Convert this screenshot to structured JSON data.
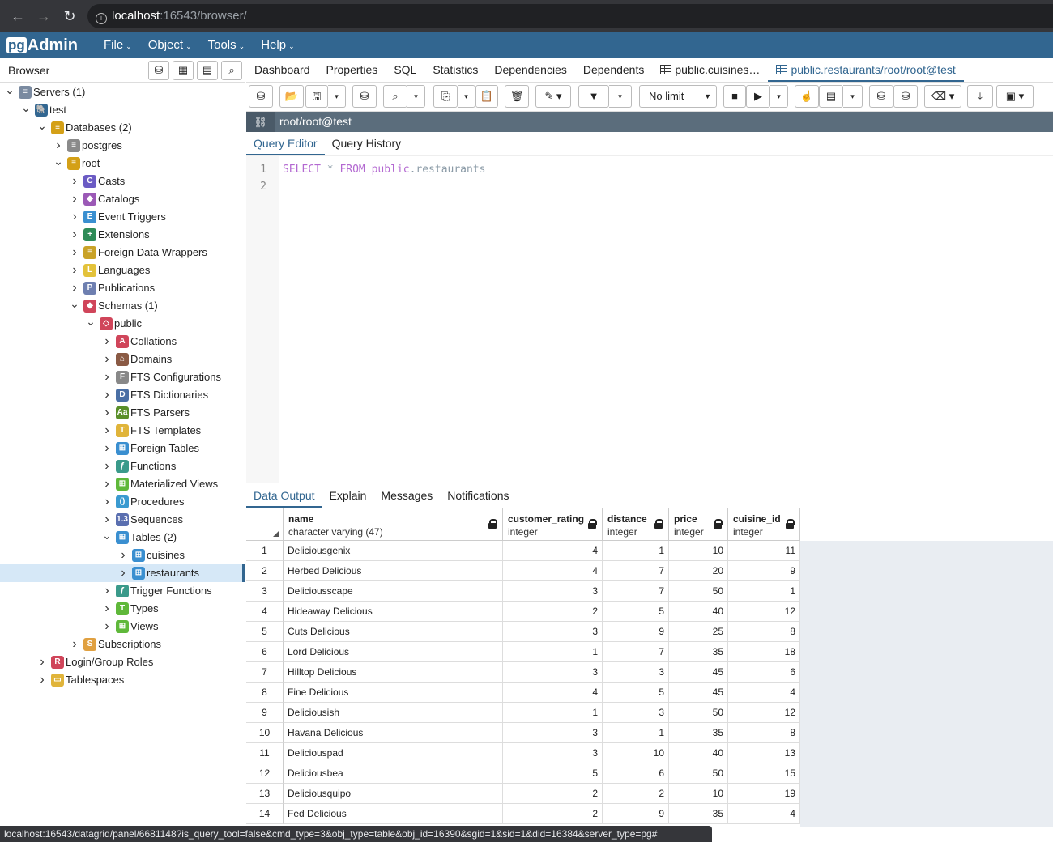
{
  "browser": {
    "url_host": "localhost",
    "url_path": ":16543/browser/",
    "status_url": "localhost:16543/datagrid/panel/6681148?is_query_tool=false&cmd_type=3&obj_type=table&obj_id=16390&sgid=1&sid=1&did=16384&server_type=pg#"
  },
  "app": {
    "logo_pg": "pg",
    "logo_admin": "Admin",
    "menu": [
      "File",
      "Object",
      "Tools",
      "Help"
    ]
  },
  "sidebar": {
    "title": "Browser",
    "tree": [
      {
        "label": "Servers (1)",
        "depth": 0,
        "chev": "v",
        "icon": "servers-icon",
        "color": "#7a8aa0",
        "glyph": "≡"
      },
      {
        "label": "test",
        "depth": 1,
        "chev": "v",
        "icon": "elephant-icon",
        "color": "#336791",
        "glyph": "🐘"
      },
      {
        "label": "Databases (2)",
        "depth": 2,
        "chev": "v",
        "icon": "databases-icon",
        "color": "#d4a017",
        "glyph": "≡"
      },
      {
        "label": "postgres",
        "depth": 3,
        "chev": ">",
        "icon": "database-icon",
        "color": "#8a8a8a",
        "glyph": "≡"
      },
      {
        "label": "root",
        "depth": 3,
        "chev": "v",
        "icon": "database-icon",
        "color": "#d4a017",
        "glyph": "≡"
      },
      {
        "label": "Casts",
        "depth": 4,
        "chev": ">",
        "icon": "casts-icon",
        "color": "#6b5bc4",
        "glyph": "C"
      },
      {
        "label": "Catalogs",
        "depth": 4,
        "chev": ">",
        "icon": "catalogs-icon",
        "color": "#9b59b6",
        "glyph": "◆"
      },
      {
        "label": "Event Triggers",
        "depth": 4,
        "chev": ">",
        "icon": "event-triggers-icon",
        "color": "#3a8fd0",
        "glyph": "E"
      },
      {
        "label": "Extensions",
        "depth": 4,
        "chev": ">",
        "icon": "extensions-icon",
        "color": "#2e8b57",
        "glyph": "+"
      },
      {
        "label": "Foreign Data Wrappers",
        "depth": 4,
        "chev": ">",
        "icon": "fdw-icon",
        "color": "#c9a227",
        "glyph": "≡"
      },
      {
        "label": "Languages",
        "depth": 4,
        "chev": ">",
        "icon": "languages-icon",
        "color": "#e3c23a",
        "glyph": "L"
      },
      {
        "label": "Publications",
        "depth": 4,
        "chev": ">",
        "icon": "publications-icon",
        "color": "#6e7fb0",
        "glyph": "P"
      },
      {
        "label": "Schemas (1)",
        "depth": 4,
        "chev": "v",
        "icon": "schemas-icon",
        "color": "#d0455a",
        "glyph": "◆"
      },
      {
        "label": "public",
        "depth": 5,
        "chev": "v",
        "icon": "schema-icon",
        "color": "#d0455a",
        "glyph": "◇"
      },
      {
        "label": "Collations",
        "depth": 6,
        "chev": ">",
        "icon": "collations-icon",
        "color": "#d0455a",
        "glyph": "A"
      },
      {
        "label": "Domains",
        "depth": 6,
        "chev": ">",
        "icon": "domains-icon",
        "color": "#8a5a44",
        "glyph": "⌂"
      },
      {
        "label": "FTS Configurations",
        "depth": 6,
        "chev": ">",
        "icon": "fts-config-icon",
        "color": "#888888",
        "glyph": "F"
      },
      {
        "label": "FTS Dictionaries",
        "depth": 6,
        "chev": ">",
        "icon": "fts-dict-icon",
        "color": "#4a6fa5",
        "glyph": "D"
      },
      {
        "label": "FTS Parsers",
        "depth": 6,
        "chev": ">",
        "icon": "fts-parsers-icon",
        "color": "#5a8f29",
        "glyph": "Aa"
      },
      {
        "label": "FTS Templates",
        "depth": 6,
        "chev": ">",
        "icon": "fts-templates-icon",
        "color": "#e0b43a",
        "glyph": "T"
      },
      {
        "label": "Foreign Tables",
        "depth": 6,
        "chev": ">",
        "icon": "foreign-tables-icon",
        "color": "#3a8fd0",
        "glyph": "⊞"
      },
      {
        "label": "Functions",
        "depth": 6,
        "chev": ">",
        "icon": "functions-icon",
        "color": "#3a9a8a",
        "glyph": "ƒ"
      },
      {
        "label": "Materialized Views",
        "depth": 6,
        "chev": ">",
        "icon": "mat-views-icon",
        "color": "#5fb83a",
        "glyph": "⊞"
      },
      {
        "label": "Procedures",
        "depth": 6,
        "chev": ">",
        "icon": "procedures-icon",
        "color": "#3a9ad0",
        "glyph": "()"
      },
      {
        "label": "Sequences",
        "depth": 6,
        "chev": ">",
        "icon": "sequences-icon",
        "color": "#5a6fb0",
        "glyph": "1.3"
      },
      {
        "label": "Tables (2)",
        "depth": 6,
        "chev": "v",
        "icon": "tables-icon",
        "color": "#3a8fd0",
        "glyph": "⊞"
      },
      {
        "label": "cuisines",
        "depth": 7,
        "chev": ">",
        "icon": "table-icon",
        "color": "#3a8fd0",
        "glyph": "⊞"
      },
      {
        "label": "restaurants",
        "depth": 7,
        "chev": ">",
        "icon": "table-icon",
        "color": "#3a8fd0",
        "glyph": "⊞",
        "selected": true
      },
      {
        "label": "Trigger Functions",
        "depth": 6,
        "chev": ">",
        "icon": "trigger-functions-icon",
        "color": "#3a9a8a",
        "glyph": "ƒ"
      },
      {
        "label": "Types",
        "depth": 6,
        "chev": ">",
        "icon": "types-icon",
        "color": "#5fb83a",
        "glyph": "T"
      },
      {
        "label": "Views",
        "depth": 6,
        "chev": ">",
        "icon": "views-icon",
        "color": "#5fb83a",
        "glyph": "⊞"
      },
      {
        "label": "Subscriptions",
        "depth": 4,
        "chev": ">",
        "icon": "subscriptions-icon",
        "color": "#e0a040",
        "glyph": "S"
      },
      {
        "label": "Login/Group Roles",
        "depth": 2,
        "chev": ">",
        "icon": "roles-icon",
        "color": "#d0455a",
        "glyph": "R"
      },
      {
        "label": "Tablespaces",
        "depth": 2,
        "chev": ">",
        "icon": "tablespaces-icon",
        "color": "#e0b43a",
        "glyph": "▭"
      }
    ]
  },
  "tabs": [
    "Dashboard",
    "Properties",
    "SQL",
    "Statistics",
    "Dependencies",
    "Dependents",
    "public.cuisines…",
    "public.restaurants/root/root@test"
  ],
  "query": {
    "limit": "No limit",
    "connection": "root/root@test",
    "subtabs": [
      "Query Editor",
      "Query History"
    ],
    "line_numbers": [
      "1",
      "2"
    ],
    "sql_select": "SELECT",
    "sql_star": "*",
    "sql_from": "FROM",
    "sql_schema": "public",
    "sql_table": ".restaurants"
  },
  "output": {
    "tabs": [
      "Data Output",
      "Explain",
      "Messages",
      "Notifications"
    ],
    "columns": [
      {
        "name": "name",
        "type": "character varying (47)"
      },
      {
        "name": "customer_rating",
        "type": "integer"
      },
      {
        "name": "distance",
        "type": "integer"
      },
      {
        "name": "price",
        "type": "integer"
      },
      {
        "name": "cuisine_id",
        "type": "integer"
      }
    ],
    "rows": [
      [
        "1",
        "Deliciousgenix",
        "4",
        "1",
        "10",
        "11"
      ],
      [
        "2",
        "Herbed Delicious",
        "4",
        "7",
        "20",
        "9"
      ],
      [
        "3",
        "Deliciousscape",
        "3",
        "7",
        "50",
        "1"
      ],
      [
        "4",
        "Hideaway Delicious",
        "2",
        "5",
        "40",
        "12"
      ],
      [
        "5",
        "Cuts Delicious",
        "3",
        "9",
        "25",
        "8"
      ],
      [
        "6",
        "Lord Delicious",
        "1",
        "7",
        "35",
        "18"
      ],
      [
        "7",
        "Hilltop Delicious",
        "3",
        "3",
        "45",
        "6"
      ],
      [
        "8",
        "Fine Delicious",
        "4",
        "5",
        "45",
        "4"
      ],
      [
        "9",
        "Deliciousish",
        "1",
        "3",
        "50",
        "12"
      ],
      [
        "10",
        "Havana Delicious",
        "3",
        "1",
        "35",
        "8"
      ],
      [
        "11",
        "Deliciouspad",
        "3",
        "10",
        "40",
        "13"
      ],
      [
        "12",
        "Deliciousbea",
        "5",
        "6",
        "50",
        "15"
      ],
      [
        "13",
        "Deliciousquipo",
        "2",
        "2",
        "10",
        "19"
      ],
      [
        "14",
        "Fed Delicious",
        "2",
        "9",
        "35",
        "4"
      ]
    ]
  }
}
